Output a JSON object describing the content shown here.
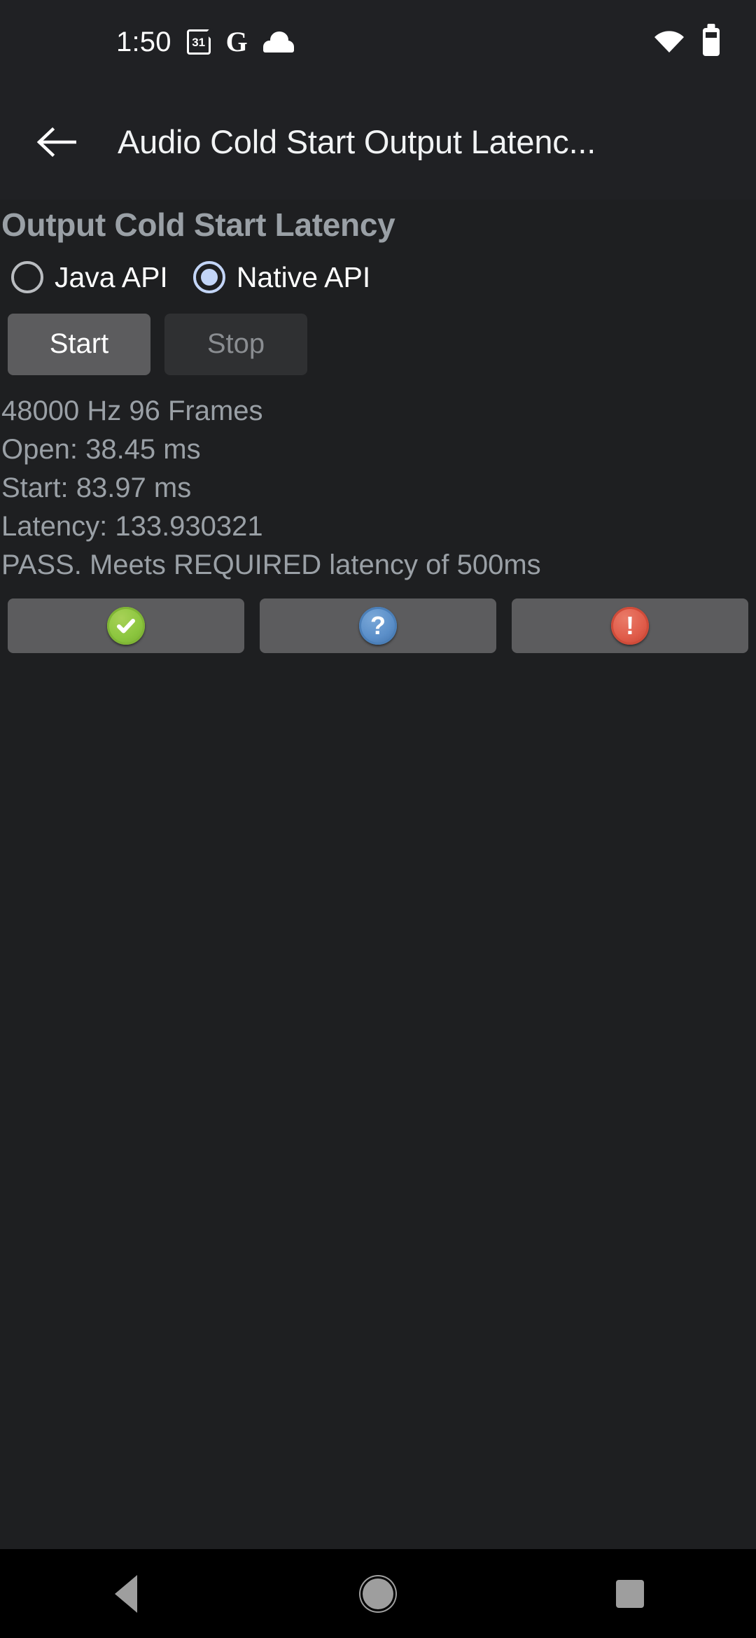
{
  "status_bar": {
    "clock": "1:50",
    "calendar_day": "31",
    "google_glyph": "G",
    "icons": [
      "calendar-icon",
      "google-icon",
      "cloud-icon",
      "wifi-icon",
      "battery-icon"
    ]
  },
  "app_bar": {
    "back_label": "back-arrow",
    "title": "Audio Cold Start Output Latenc..."
  },
  "main": {
    "section_title": "Output Cold Start Latency",
    "api_options": [
      {
        "label": "Java API",
        "selected": false
      },
      {
        "label": "Native API",
        "selected": true
      }
    ],
    "buttons": {
      "start_label": "Start",
      "stop_label": "Stop",
      "start_enabled": "true",
      "stop_enabled": "false"
    },
    "results": [
      "48000 Hz 96 Frames",
      "Open: 38.45 ms",
      "Start: 83.97 ms",
      "Latency: 133.930321",
      "PASS. Meets REQUIRED latency of 500ms"
    ],
    "status_buttons": [
      {
        "icon": "check-circle-icon",
        "color": "#8cc63f",
        "glyph": ""
      },
      {
        "icon": "question-circle-icon",
        "color": "#5b8fc9",
        "glyph": "?"
      },
      {
        "icon": "exclamation-circle-icon",
        "color": "#e05c4a",
        "glyph": "!"
      }
    ]
  },
  "nav_bar": {
    "back": "back-nav-button",
    "home": "home-nav-button",
    "recents": "recents-nav-button"
  },
  "colors": {
    "app_background": "#1e1f21",
    "bar_background": "#202124",
    "nav_background": "#000000",
    "text_primary": "#ffffff",
    "text_secondary": "#9aa0a6",
    "accent_radio": "#c3d5f7",
    "button_enabled": "#5c5c5e",
    "button_disabled": "#2f3032"
  }
}
